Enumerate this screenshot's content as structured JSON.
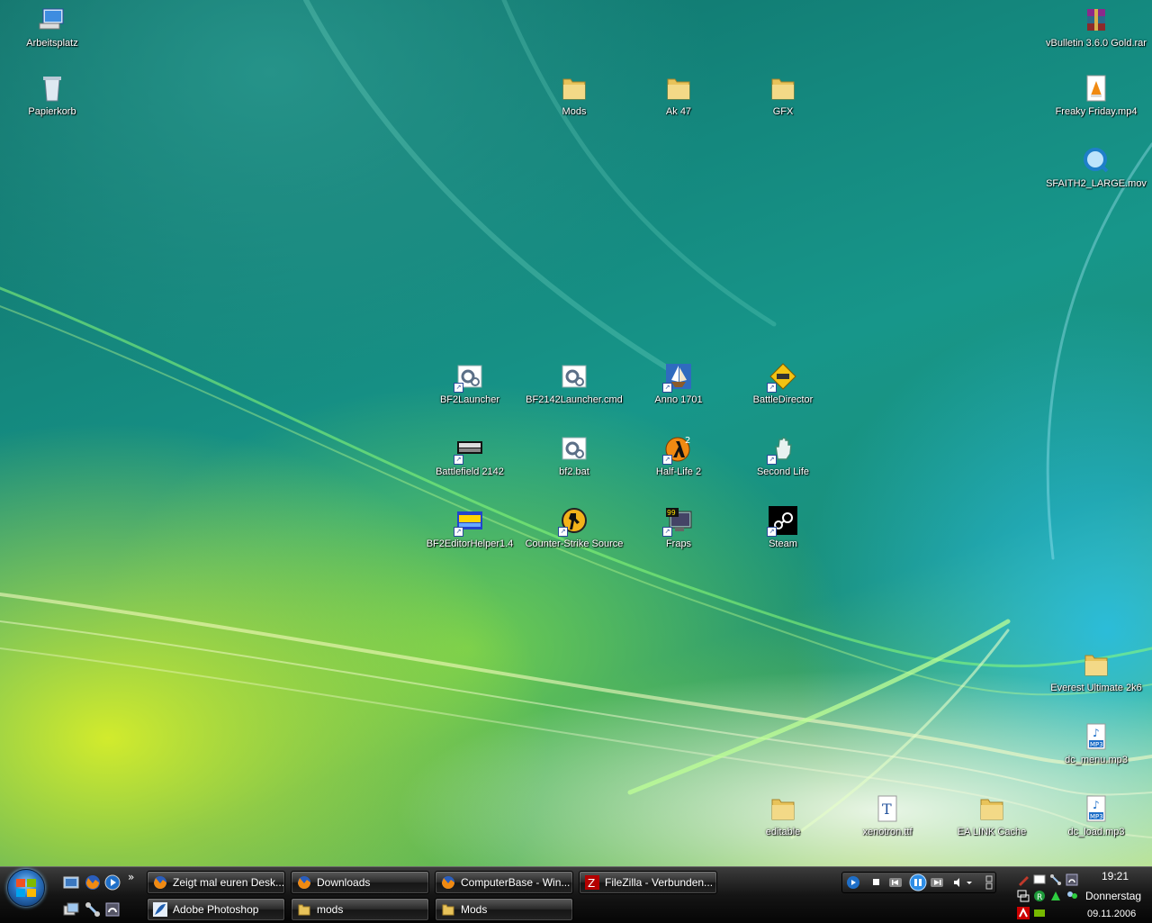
{
  "desktop_icons": [
    {
      "label": "Arbeitsplatz"
    },
    {
      "label": "Papierkorb"
    },
    {
      "label": "Mods"
    },
    {
      "label": "Ak 47"
    },
    {
      "label": "GFX"
    },
    {
      "label": "vBulletin 3.6.0 Gold.rar"
    },
    {
      "label": "Freaky Friday.mp4"
    },
    {
      "label": "SFAITH2_LARGE.mov"
    },
    {
      "label": "BF2Launcher"
    },
    {
      "label": "BF2142Launcher.cmd"
    },
    {
      "label": "Anno 1701"
    },
    {
      "label": "BattleDirector"
    },
    {
      "label": "Battlefield 2142"
    },
    {
      "label": "bf2.bat"
    },
    {
      "label": "Half-Life 2"
    },
    {
      "label": "Second Life"
    },
    {
      "label": "BF2EditorHelper1.4"
    },
    {
      "label": "Counter-Strike Source"
    },
    {
      "label": "Fraps"
    },
    {
      "label": "Steam"
    },
    {
      "label": "Everest Ultimate 2k6"
    },
    {
      "label": "dc_menu.mp3"
    },
    {
      "label": "editable"
    },
    {
      "label": "xenotron.ttf"
    },
    {
      "label": "EA LINK Cache"
    },
    {
      "label": "dc_load.mp3"
    }
  ],
  "taskbar": {
    "chevron": "»",
    "buttons": [
      {
        "label": "Zeigt mal euren Desk...",
        "icon": "firefox-icon"
      },
      {
        "label": "Downloads",
        "icon": "firefox-icon"
      },
      {
        "label": "ComputerBase - Win...",
        "icon": "firefox-icon"
      },
      {
        "label": "FileZilla - Verbunden...",
        "icon": "filezilla-icon"
      },
      {
        "label": "Adobe Photoshop",
        "icon": "photoshop-icon"
      },
      {
        "label": "mods",
        "icon": "folder-icon"
      },
      {
        "label": "Mods",
        "icon": "folder-icon"
      }
    ],
    "clock": {
      "time": "19:21",
      "day": "Donnerstag",
      "date": "09.11.2006"
    }
  },
  "colors": {
    "folder": "#e8c35a",
    "taskbar": "#151515",
    "accent": "#2a72c0"
  }
}
